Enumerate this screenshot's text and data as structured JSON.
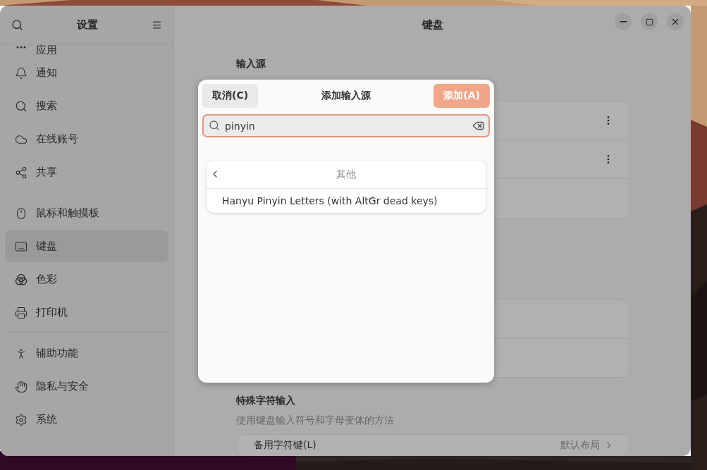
{
  "window": {
    "sidebar_title": "设置",
    "page_title": "键盘"
  },
  "sidebar": {
    "groups": [
      [
        {
          "label": "应用",
          "selected": false
        },
        {
          "label": "通知",
          "selected": false
        },
        {
          "label": "搜索",
          "selected": false
        },
        {
          "label": "在线账号",
          "selected": false
        },
        {
          "label": "共享",
          "selected": false
        }
      ],
      [
        {
          "label": "鼠标和触摸板",
          "selected": false
        },
        {
          "label": "键盘",
          "selected": true
        },
        {
          "label": "色彩",
          "selected": false
        },
        {
          "label": "打印机",
          "selected": false
        }
      ],
      [
        {
          "label": "辅助功能",
          "selected": false
        },
        {
          "label": "隐私与安全",
          "selected": false
        },
        {
          "label": "系统",
          "selected": false
        }
      ]
    ]
  },
  "input_sources": {
    "heading": "输入源",
    "rows": [
      {
        "kind": "menu"
      },
      {
        "kind": "menu"
      },
      {
        "kind": "plain"
      }
    ]
  },
  "switching": {
    "rows": [
      {
        "kind": "plain"
      },
      {
        "kind": "plain"
      }
    ]
  },
  "special_input": {
    "heading": "特殊字符输入",
    "description": "使用键盘输入符号和字母变体的方法",
    "rows": [
      {
        "label": "备用字符键(L)",
        "value": "默认布局"
      }
    ]
  },
  "dialog": {
    "cancel": "取消(C)",
    "title": "添加输入源",
    "add": "添加(A)",
    "search": {
      "value": "pinyin"
    },
    "group": {
      "title": "其他",
      "items": [
        {
          "label": "Hanyu Pinyin Letters (with AltGr dead keys)",
          "selected": false
        }
      ]
    }
  }
}
